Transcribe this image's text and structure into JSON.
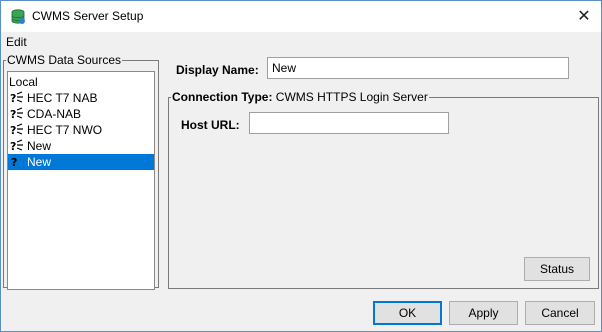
{
  "window": {
    "title": "CWMS Server Setup",
    "close_glyph": "✕"
  },
  "menubar": {
    "items": [
      {
        "label": "Edit"
      }
    ]
  },
  "sources": {
    "legend": "CWMS Data Sources",
    "items": [
      {
        "label": "Local",
        "icon": "none",
        "selected": false
      },
      {
        "label": "HEC T7 NAB",
        "icon": "server-question-icon",
        "selected": false
      },
      {
        "label": "CDA-NAB",
        "icon": "server-question-icon",
        "selected": false
      },
      {
        "label": "HEC T7 NWO",
        "icon": "server-question-icon",
        "selected": false
      },
      {
        "label": "New",
        "icon": "server-question-icon",
        "selected": false
      },
      {
        "label": "New",
        "icon": "server-question-icon",
        "selected": true
      }
    ]
  },
  "form": {
    "display_name_label": "Display Name:",
    "display_name_value": "New",
    "connection_type_label": "Connection Type:",
    "connection_type_value": "CWMS HTTPS Login Server",
    "host_url_label": "Host URL:",
    "host_url_value": ""
  },
  "buttons": {
    "status": "Status",
    "ok": "OK",
    "apply": "Apply",
    "cancel": "Cancel"
  },
  "colors": {
    "selection": "#0078d7",
    "window_border": "#5a8fc7",
    "panel_bg": "#f0f0f0"
  }
}
